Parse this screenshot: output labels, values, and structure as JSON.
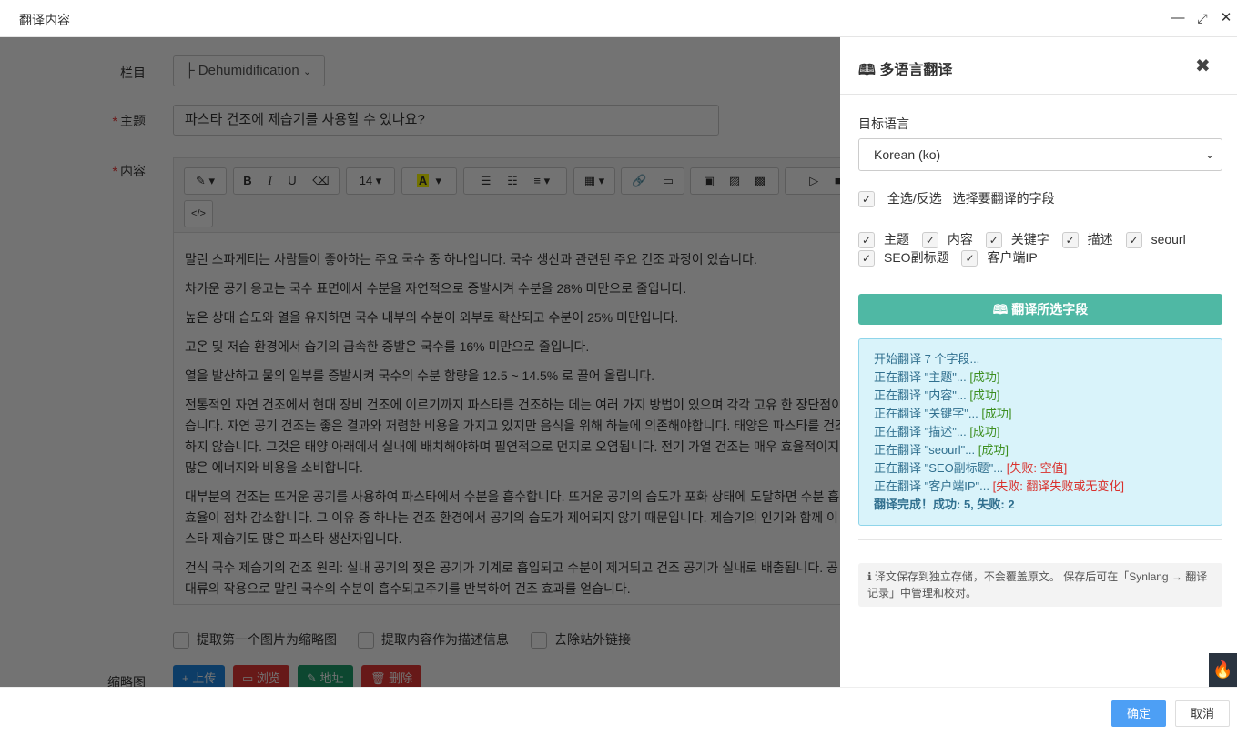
{
  "window": {
    "title": "翻译内容",
    "min": "—",
    "max": "⤢",
    "close": "✕"
  },
  "form": {
    "category_label": "栏目",
    "category_value": "├ Dehumidification",
    "subject_label": "主题",
    "subject_value": "파스타 건조에 제습기를 사용할 수 있나요?",
    "content_label": "内容",
    "req": "*",
    "toolbar": {
      "fontsize": "14"
    },
    "paragraphs": [
      "말린 스파게티는 사람들이 좋아하는 주요 국수 중 하나입니다. 국수 생산과 관련된 주요 건조 과정이 있습니다.",
      "차가운 공기 응고는 국수 표면에서 수분을 자연적으로 증발시켜 수분을 28% 미만으로 줄입니다.",
      "높은 상대 습도와 열을 유지하면 국수 내부의 수분이 외부로 확산되고 수분이 25% 미만입니다.",
      "고온 및 저습 환경에서 습기의 급속한 증발은 국수를 16% 미만으로 줄입니다.",
      "열을 발산하고 물의 일부를 증발시켜 국수의 수분 함량을 12.5 ~ 14.5% 로 끌어 올립니다.",
      "전통적인 자연 건조에서 현대 장비 건조에 이르기까지 파스타를 건조하는 데는 여러 가지 방법이 있으며 각각 고유 한 장단점이 있습니다. 자연 공기 건조는 좋은 결과와 저렴한 비용을 가지고 있지만 음식을 위해 하늘에 의존해야합니다. 태양은 파스타를 건조 하지 않습니다. 그것은 태양 아래에서 실내에 배치해야하며 필연적으로 먼지로 오염됩니다. 전기 가열 건조는 매우 효율적이지 만 많은 에너지와 비용을 소비합니다.",
      "대부분의 건조는 뜨거운 공기를 사용하여 파스타에서 수분을 흡수합니다. 뜨거운 공기의 습도가 포화 상태에 도달하면 수분 흡 수 효율이 점차 감소합니다. 그 이유 중 하나는 건조 환경에서 공기의 습도가 제어되지 않기 때문입니다. 제습기의 인기와 함께 이 파스타 제습기도 많은 파스타 생산자입니다.",
      "건식 국수 제습기의 건조 원리: 실내 공기의 젖은 공기가 기계로 흡입되고 수분이 제거되고 건조 공기가 실내로 배출됩니다. 공 기 대류의 작용으로 말린 국수의 수분이 흡수되고주기를 반복하여 건조 효과를 얻습니다."
    ],
    "options": [
      "提取第一个图片为缩略图",
      "提取内容作为描述信息",
      "去除站外链接"
    ],
    "thumb_label": "缩略图",
    "upload_buttons": [
      {
        "label": "上传",
        "icon": "+",
        "color": "#1e88e5"
      },
      {
        "label": "浏览",
        "icon": "▭",
        "color": "#e53935"
      },
      {
        "label": "地址",
        "icon": "✎",
        "color": "#1e9e6a"
      },
      {
        "label": "删除",
        "icon": "🗑",
        "color": "#e53935"
      }
    ]
  },
  "panel": {
    "title": "多语言翻译",
    "close": "✖",
    "target_label": "目标语言",
    "language": "Korean (ko)",
    "select_all": "全选/反选",
    "select_hint": "选择要翻译的字段",
    "fields_row1": [
      "主题",
      "内容",
      "关键字",
      "描述",
      "seourl"
    ],
    "fields_row2": [
      "SEO副标题",
      "客户端IP"
    ],
    "translate_button": "翻译所选字段",
    "log": {
      "start": "开始翻译 7 个字段...",
      "lines": [
        {
          "text": "正在翻译 \"主题\"...",
          "status": "[成功]",
          "ok": true
        },
        {
          "text": "正在翻译 \"内容\"...",
          "status": "[成功]",
          "ok": true
        },
        {
          "text": "正在翻译 \"关键字\"...",
          "status": "[成功]",
          "ok": true
        },
        {
          "text": "正在翻译 \"描述\"...",
          "status": "[成功]",
          "ok": true
        },
        {
          "text": "正在翻译 \"seourl\"...",
          "status": "[成功]",
          "ok": true
        },
        {
          "text": "正在翻译 \"SEO副标题\"...",
          "status": "[失败: 空值]",
          "ok": false
        },
        {
          "text": "正在翻译 \"客户端IP\"...",
          "status": "[失败: 翻译失败或无变化]",
          "ok": false
        }
      ],
      "done": "翻译完成！成功: 5, 失败: 2"
    },
    "note": "译文保存到独立存储，不会覆盖原文。 保存后可在「Synlang → 翻译记录」中管理和校对。"
  },
  "footer": {
    "ok": "确定",
    "cancel": "取消"
  }
}
